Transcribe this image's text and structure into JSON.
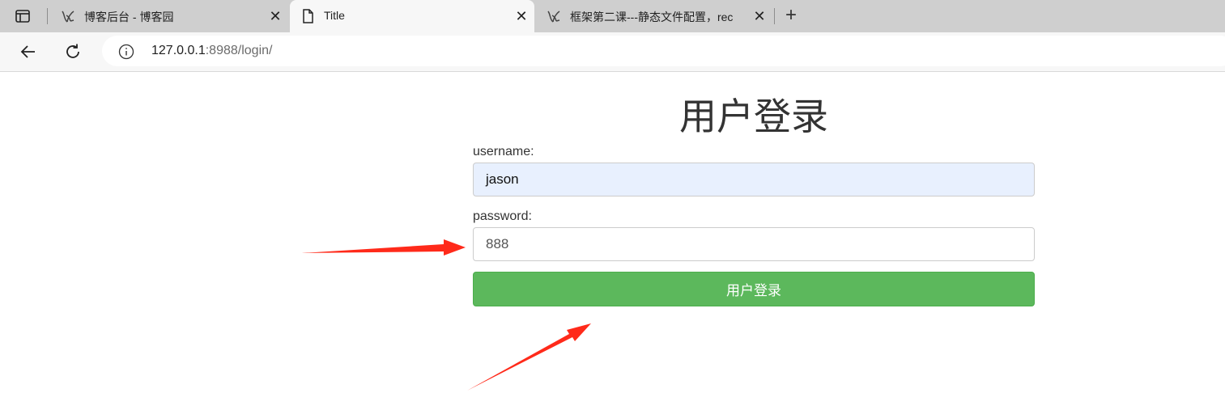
{
  "browser": {
    "tabs": [
      {
        "title": "博客后台 - 博客园",
        "icon": "cnblogs-logo-icon"
      },
      {
        "title": "Title",
        "icon": "document-icon",
        "active": true
      },
      {
        "title": "框架第二课---静态文件配置，rec",
        "icon": "cnblogs-logo-icon"
      }
    ],
    "new_tab_symbol": "+",
    "url_host": "127.0.0.1",
    "url_rest": ":8988/login/"
  },
  "page": {
    "title": "用户登录",
    "username_label": "username:",
    "username_value": "jason",
    "password_label": "password:",
    "password_value": "888",
    "login_button": "用户登录"
  },
  "annotations": {
    "arrow_color": "#ff2a1a"
  }
}
